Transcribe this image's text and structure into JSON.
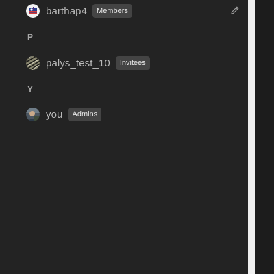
{
  "members_list": {
    "rows": [
      {
        "username": "barthap4",
        "role_badge": "Members",
        "avatar_icon": "avatar-flag-icon",
        "edit_icon": "pencil-icon"
      }
    ],
    "groups": [
      {
        "letter": "P",
        "rows": [
          {
            "username": "palys_test_10",
            "role_badge": "Invitees",
            "avatar_icon": "avatar-pattern-icon"
          }
        ]
      },
      {
        "letter": "Y",
        "rows": [
          {
            "username": "you",
            "role_badge": "Admins",
            "avatar_icon": "avatar-photo-icon"
          }
        ]
      }
    ]
  },
  "colors": {
    "panel_background": "#232323",
    "badge_background": "#444444",
    "text_primary": "#b9b9b9",
    "group_letter": "#a9a9a9"
  }
}
